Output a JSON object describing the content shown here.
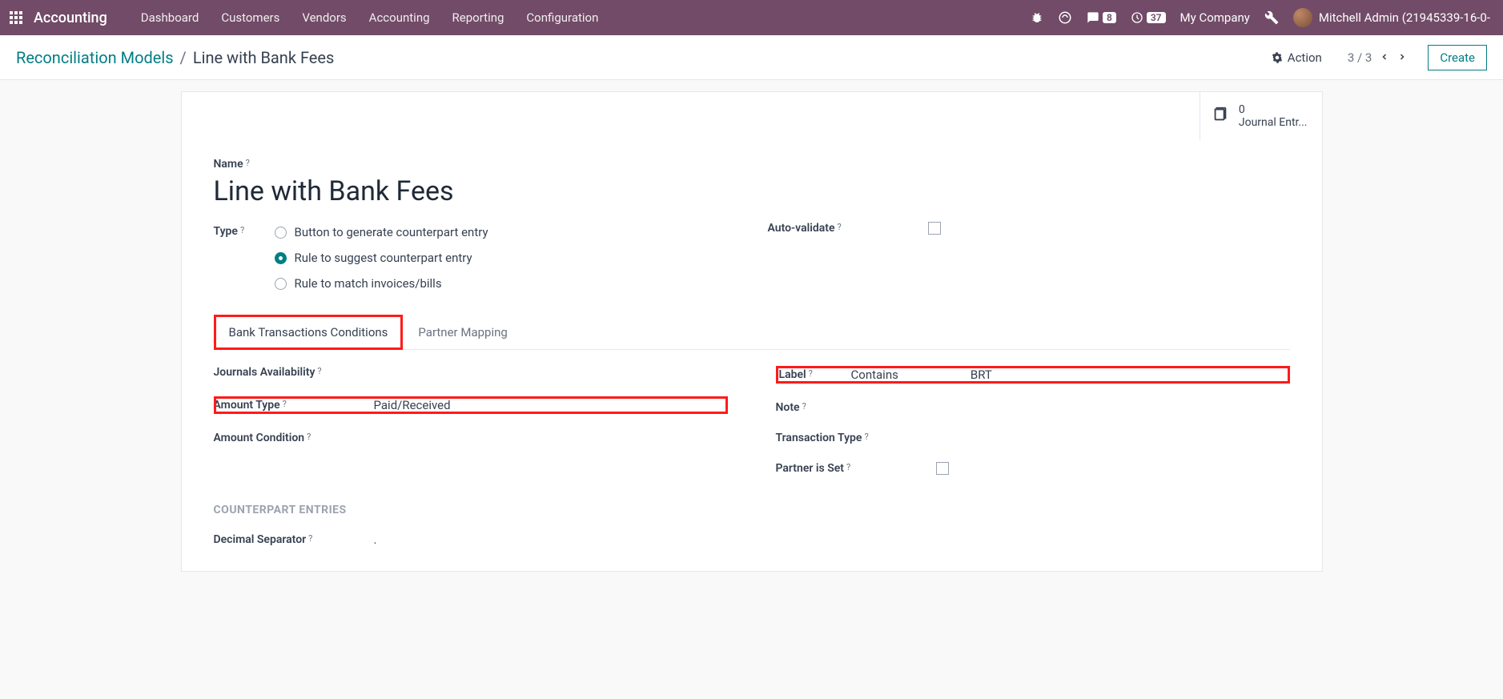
{
  "nav": {
    "brand": "Accounting",
    "links": [
      "Dashboard",
      "Customers",
      "Vendors",
      "Accounting",
      "Reporting",
      "Configuration"
    ],
    "messages_badge": "8",
    "activities_badge": "37",
    "company": "My Company",
    "user": "Mitchell Admin (21945339-16-0-"
  },
  "breadcrumb": {
    "parent": "Reconciliation Models",
    "current": "Line with Bank Fees"
  },
  "header": {
    "action": "Action",
    "pager": "3 / 3",
    "create": "Create"
  },
  "smart": {
    "count": "0",
    "label": "Journal Entr..."
  },
  "form": {
    "name_label": "Name",
    "name_value": "Line with Bank Fees",
    "type_label": "Type",
    "type_options": [
      "Button to generate counterpart entry",
      "Rule to suggest counterpart entry",
      "Rule to match invoices/bills"
    ],
    "type_selected_index": 1,
    "autovalidate_label": "Auto-validate"
  },
  "tabs": {
    "t0": "Bank Transactions Conditions",
    "t1": "Partner Mapping"
  },
  "conditions": {
    "journals_label": "Journals Availability",
    "amount_type_label": "Amount Type",
    "amount_type_value": "Paid/Received",
    "amount_condition_label": "Amount Condition",
    "label_label": "Label",
    "label_op": "Contains",
    "label_value": "BRT",
    "note_label": "Note",
    "txn_type_label": "Transaction Type",
    "partner_set_label": "Partner is Set"
  },
  "counterpart": {
    "header": "COUNTERPART ENTRIES",
    "decimal_sep_label": "Decimal Separator",
    "decimal_sep_value": "."
  }
}
